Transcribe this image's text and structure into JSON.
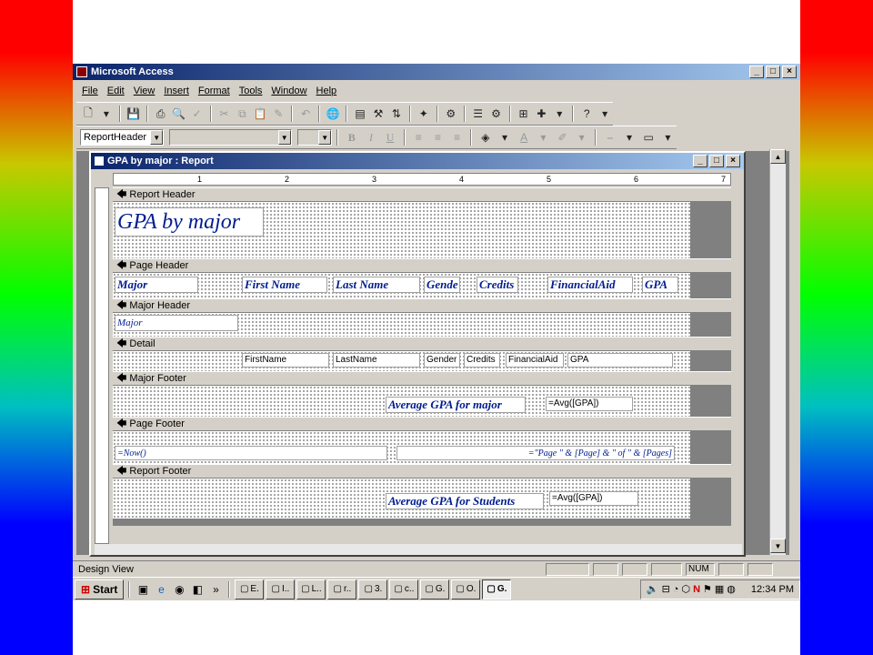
{
  "window": {
    "title": "Microsoft Access"
  },
  "menu": [
    "File",
    "Edit",
    "View",
    "Insert",
    "Format",
    "Tools",
    "Window",
    "Help"
  ],
  "toolbar2": {
    "object_combo": "ReportHeader"
  },
  "report_window": {
    "title": "GPA by major : Report"
  },
  "ruler": {
    "numbers": [
      "1",
      "2",
      "3",
      "4",
      "5",
      "6",
      "7"
    ]
  },
  "sections": {
    "report_header": "Report Header",
    "page_header": "Page Header",
    "major_header": "Major Header",
    "detail": "Detail",
    "major_footer": "Major Footer",
    "page_footer": "Page Footer",
    "report_footer": "Report Footer"
  },
  "report_header": {
    "title": "GPA by major"
  },
  "page_header": {
    "labels": [
      "Major",
      "First Name",
      "Last Name",
      "Gende",
      "Credits",
      "FinancialAid",
      "GPA"
    ]
  },
  "major_header": {
    "field": "Major"
  },
  "detail": {
    "fields": [
      "FirstName",
      "LastName",
      "Gender",
      "Credits",
      "FinancialAid",
      "GPA"
    ]
  },
  "major_footer": {
    "label": "Average GPA for major",
    "expr": "=Avg([GPA])"
  },
  "page_footer": {
    "now_expr": "=Now()",
    "page_expr": "=\"Page \" & [Page] & \" of \" & [Pages]"
  },
  "report_footer": {
    "label": "Average GPA for Students",
    "expr": "=Avg([GPA])"
  },
  "status": {
    "mode": "Design View",
    "num": "NUM"
  },
  "taskbar": {
    "start": "Start",
    "tasks": [
      "E.",
      "I..",
      "L..",
      "r..",
      "3.",
      "c..",
      "G.",
      "O.",
      "G."
    ],
    "time": "12:34 PM"
  }
}
